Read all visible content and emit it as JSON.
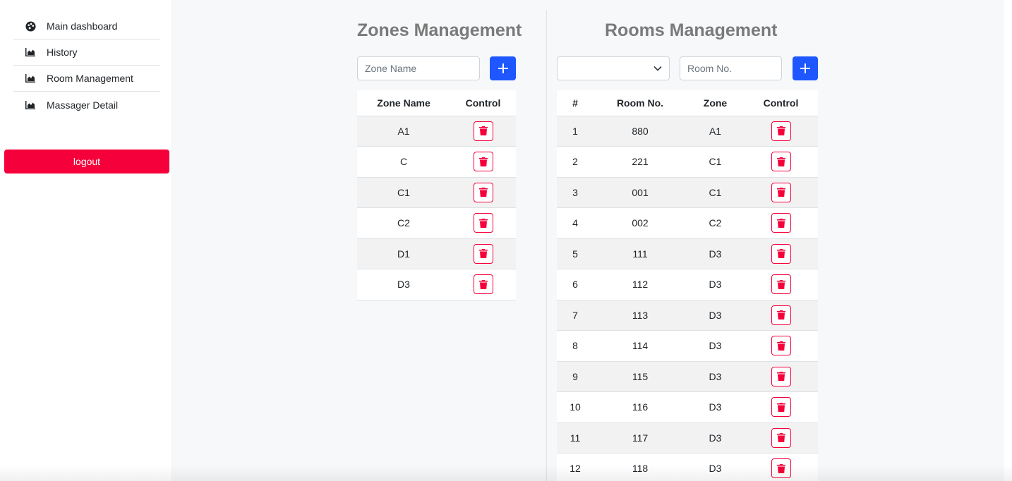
{
  "sidebar": {
    "items": [
      {
        "label": "Main dashboard",
        "icon": "palette-icon"
      },
      {
        "label": "History",
        "icon": "area-chart-icon"
      },
      {
        "label": "Room Management",
        "icon": "area-chart-icon"
      },
      {
        "label": "Massager Detail",
        "icon": "area-chart-icon"
      }
    ],
    "logout_label": "logout"
  },
  "zones": {
    "title": "Zones Management",
    "input_placeholder": "Zone Name",
    "add_button_icon": "plus-icon",
    "columns": [
      "Zone Name",
      "Control"
    ],
    "rows": [
      "A1",
      "C",
      "C1",
      "C2",
      "D1",
      "D3"
    ]
  },
  "rooms": {
    "title": "Rooms Management",
    "zone_select_value": "",
    "input_placeholder": "Room No.",
    "add_button_icon": "plus-icon",
    "columns": [
      "#",
      "Room No.",
      "Zone",
      "Control"
    ],
    "rows": [
      {
        "index": "1",
        "room": "880",
        "zone": "A1"
      },
      {
        "index": "2",
        "room": "221",
        "zone": "C1"
      },
      {
        "index": "3",
        "room": "001",
        "zone": "C1"
      },
      {
        "index": "4",
        "room": "002",
        "zone": "C2"
      },
      {
        "index": "5",
        "room": "111",
        "zone": "D3"
      },
      {
        "index": "6",
        "room": "112",
        "zone": "D3"
      },
      {
        "index": "7",
        "room": "113",
        "zone": "D3"
      },
      {
        "index": "8",
        "room": "114",
        "zone": "D3"
      },
      {
        "index": "9",
        "room": "115",
        "zone": "D3"
      },
      {
        "index": "10",
        "room": "116",
        "zone": "D3"
      },
      {
        "index": "11",
        "room": "117",
        "zone": "D3"
      },
      {
        "index": "12",
        "room": "118",
        "zone": "D3"
      }
    ]
  },
  "colors": {
    "accent_blue": "#1e57ff",
    "danger_red": "#f5003a",
    "heading_gray": "#7a7a7a",
    "striped_row": "#f2f2f2"
  }
}
